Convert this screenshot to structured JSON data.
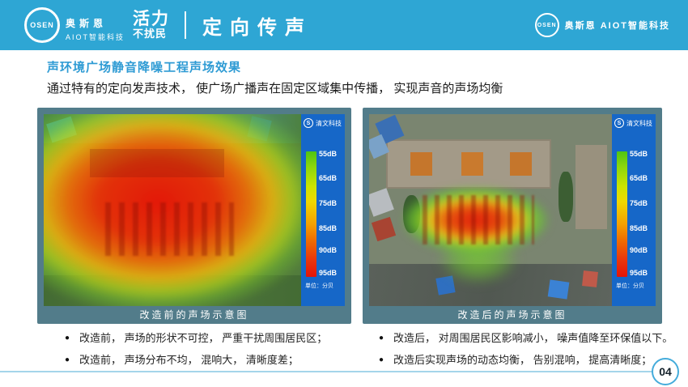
{
  "page": {
    "accent": "#2EA6D4",
    "frame_color": "#527C8A",
    "panel_color": "#1667C8",
    "rule_color": "#A5D5EA"
  },
  "icons": {
    "bullet": "●"
  },
  "header": {
    "title": "定向传声",
    "logo_left": {
      "circle_text": "OSEN",
      "name": "奥斯恩",
      "subtitle": "AIOT智能科技"
    },
    "slogan": {
      "line1": "活力",
      "line2": "不扰民"
    },
    "logo_right": {
      "circle_text": "OSEN",
      "text": "奥斯恩 AIOT智能科技"
    }
  },
  "section": {
    "heading": "声环境广场静音降噪工程声场效果",
    "description": "通过特有的定向发声技术， 使广场广播声在固定区域集中传播， 实现声音的声场均衡"
  },
  "figures": [
    {
      "caption": "改造前的声场示意图",
      "watermark": "清文科技",
      "watermark_icon": "S",
      "scale": {
        "labels": [
          "55dB",
          "65dB",
          "75dB",
          "85dB",
          "90dB",
          "95dB"
        ],
        "unit": "单位：分贝"
      }
    },
    {
      "caption": "改造后的声场示意图",
      "watermark": "清文科技",
      "watermark_icon": "S",
      "scale": {
        "labels": [
          "55dB",
          "65dB",
          "75dB",
          "85dB",
          "90dB",
          "95dB"
        ],
        "unit": "单位：分贝"
      }
    }
  ],
  "bullets_left": [
    "改造前， 声场的形状不可控， 严重干扰周围居民区；",
    "改造前， 声场分布不均， 混响大， 清晰度差；"
  ],
  "bullets_right": [
    "改造后， 对周围居民区影响减小， 噪声值降至环保值以下。",
    "改造后实现声场的动态均衡， 告别混响， 提高清晰度；"
  ],
  "page_number": "04"
}
